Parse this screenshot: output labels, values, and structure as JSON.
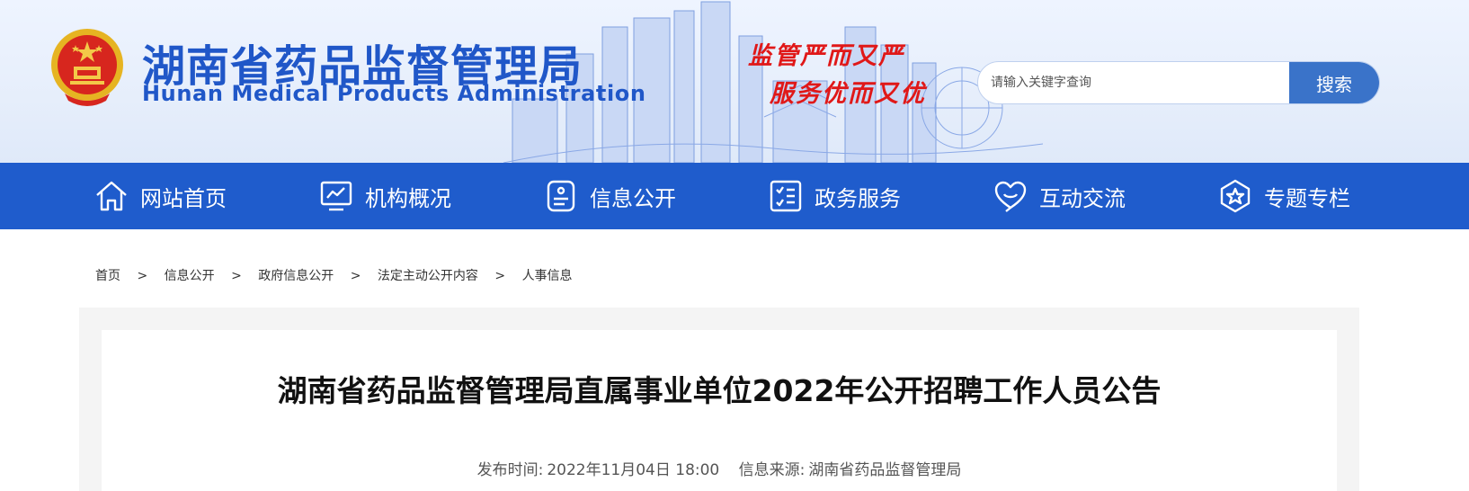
{
  "header": {
    "title_cn": "湖南省药品监督管理局",
    "title_en": "Hunan Medical Products Administration",
    "slogan_line1": "监管严而又严",
    "slogan_line2": "服务优而又优"
  },
  "search": {
    "placeholder": "请输入关键字查询",
    "value": "",
    "button_label": "搜索"
  },
  "nav": {
    "items": [
      {
        "label": "网站首页",
        "icon": "home-icon"
      },
      {
        "label": "机构概况",
        "icon": "monitor-chart-icon"
      },
      {
        "label": "信息公开",
        "icon": "document-icon"
      },
      {
        "label": "政务服务",
        "icon": "checklist-icon"
      },
      {
        "label": "互动交流",
        "icon": "heart-chat-icon"
      },
      {
        "label": "专题专栏",
        "icon": "star-badge-icon"
      }
    ]
  },
  "breadcrumb": {
    "items": [
      "首页",
      "信息公开",
      "政府信息公开",
      "法定主动公开内容",
      "人事信息"
    ],
    "separator": ">"
  },
  "article": {
    "title": "湖南省药品监督管理局直属事业单位2022年公开招聘工作人员公告",
    "publish_label": "发布时间:",
    "publish_time": "2022年11月04日 18:00",
    "source_label": "信息来源:",
    "source": "湖南省药品监督管理局"
  },
  "colors": {
    "brand_blue": "#1f5ccc",
    "title_blue": "#2057c8",
    "slogan_red": "#e01818",
    "search_button": "#3a73c9"
  }
}
